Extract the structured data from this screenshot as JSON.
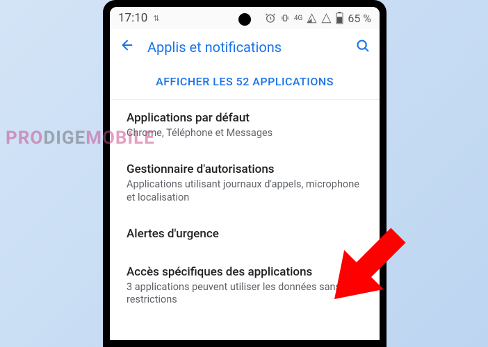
{
  "status_bar": {
    "time": "17:10",
    "network_type": "4G",
    "battery_percent": "65 %"
  },
  "app_bar": {
    "title": "Applis et notifications"
  },
  "show_all_apps": {
    "label": "AFFICHER LES 52 APPLICATIONS"
  },
  "settings": [
    {
      "title": "Applications par défaut",
      "subtitle": "Chrome, Téléphone et Messages"
    },
    {
      "title": "Gestionnaire d'autorisations",
      "subtitle": "Applications utilisant journaux d'appels, microphone et localisation"
    },
    {
      "title": "Alertes d'urgence",
      "subtitle": ""
    },
    {
      "title": "Accès spécifiques des applications",
      "subtitle": "3 applications peuvent utiliser les données sans restrictions"
    }
  ],
  "watermark": {
    "pro": "PRO",
    "dige": "DIGE",
    "mobile": "MOBILE"
  }
}
